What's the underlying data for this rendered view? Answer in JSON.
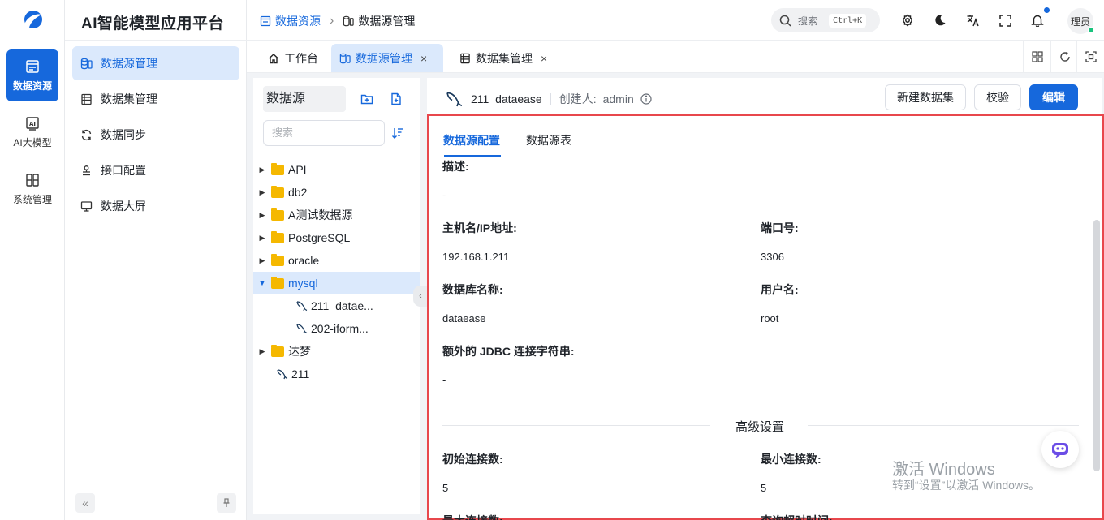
{
  "rail": {
    "items": [
      {
        "label": "数据资源",
        "icon": "datasource-icon",
        "active": true
      },
      {
        "label": "AI大模型",
        "icon": "ai-chip-icon"
      },
      {
        "label": "系统管理",
        "icon": "system-grid-icon"
      }
    ]
  },
  "sidebar": {
    "brand": "AI智能模型应用平台",
    "items": [
      {
        "label": "数据源管理",
        "icon": "database-icon",
        "active": true
      },
      {
        "label": "数据集管理",
        "icon": "list-icon"
      },
      {
        "label": "数据同步",
        "icon": "sync-icon"
      },
      {
        "label": "接口配置",
        "icon": "api-icon"
      },
      {
        "label": "数据大屏",
        "icon": "monitor-icon"
      }
    ],
    "collapse_label": "«"
  },
  "header": {
    "breadcrumb": [
      "数据资源",
      "数据源管理"
    ],
    "breadcrumb_sep": "›",
    "search_placeholder": "搜索",
    "search_shortcut": "Ctrl+K",
    "user_name": "理员"
  },
  "tabs": [
    {
      "label": "工作台",
      "icon": "home-icon",
      "closable": false
    },
    {
      "label": "数据源管理",
      "icon": "database-icon",
      "active": true,
      "closable": true
    },
    {
      "label": "数据集管理",
      "icon": "list-icon",
      "closable": true
    }
  ],
  "tab_close": "×",
  "tree": {
    "title": "数据源",
    "search_placeholder": "搜索",
    "nodes": [
      {
        "label": "API",
        "type": "folder"
      },
      {
        "label": "db2",
        "type": "folder"
      },
      {
        "label": "A测试数据源",
        "type": "folder"
      },
      {
        "label": "PostgreSQL",
        "type": "folder"
      },
      {
        "label": "oracle",
        "type": "folder"
      },
      {
        "label": "mysql",
        "type": "folder",
        "expanded": true,
        "selected": true
      },
      {
        "label": "211_datae...",
        "type": "source",
        "child": true
      },
      {
        "label": "202-iform...",
        "type": "source",
        "child": true
      },
      {
        "label": "达梦",
        "type": "folder"
      },
      {
        "label": "211",
        "type": "source"
      }
    ]
  },
  "detail": {
    "name": "211_dataease",
    "creator_label": "创建人:",
    "creator": "admin",
    "buttons": {
      "new_dataset": "新建数据集",
      "validate": "校验",
      "edit": "编辑"
    },
    "tabs": [
      "数据源配置",
      "数据源表"
    ],
    "desc_label": "描述:",
    "desc_value": "-",
    "host_label": "主机名/IP地址:",
    "host_value": "192.168.1.211",
    "port_label": "端口号:",
    "port_value": "3306",
    "db_label": "数据库名称:",
    "db_value": "dataease",
    "user_label": "用户名:",
    "user_value": "root",
    "jdbc_label": "额外的 JDBC 连接字符串:",
    "jdbc_value": "-",
    "advanced_title": "高级设置",
    "init_conn_label": "初始连接数:",
    "init_conn_value": "5",
    "min_conn_label": "最小连接数:",
    "min_conn_value": "5",
    "max_conn_label": "最大连接数:",
    "timeout_label": "查询超时时间:"
  },
  "watermark": {
    "line1": "激活 Windows",
    "line2": "转到“设置”以激活 Windows。"
  },
  "colors": {
    "accent": "#1668dc",
    "highlight_border": "#e8474c",
    "folder": "#f5b800"
  }
}
